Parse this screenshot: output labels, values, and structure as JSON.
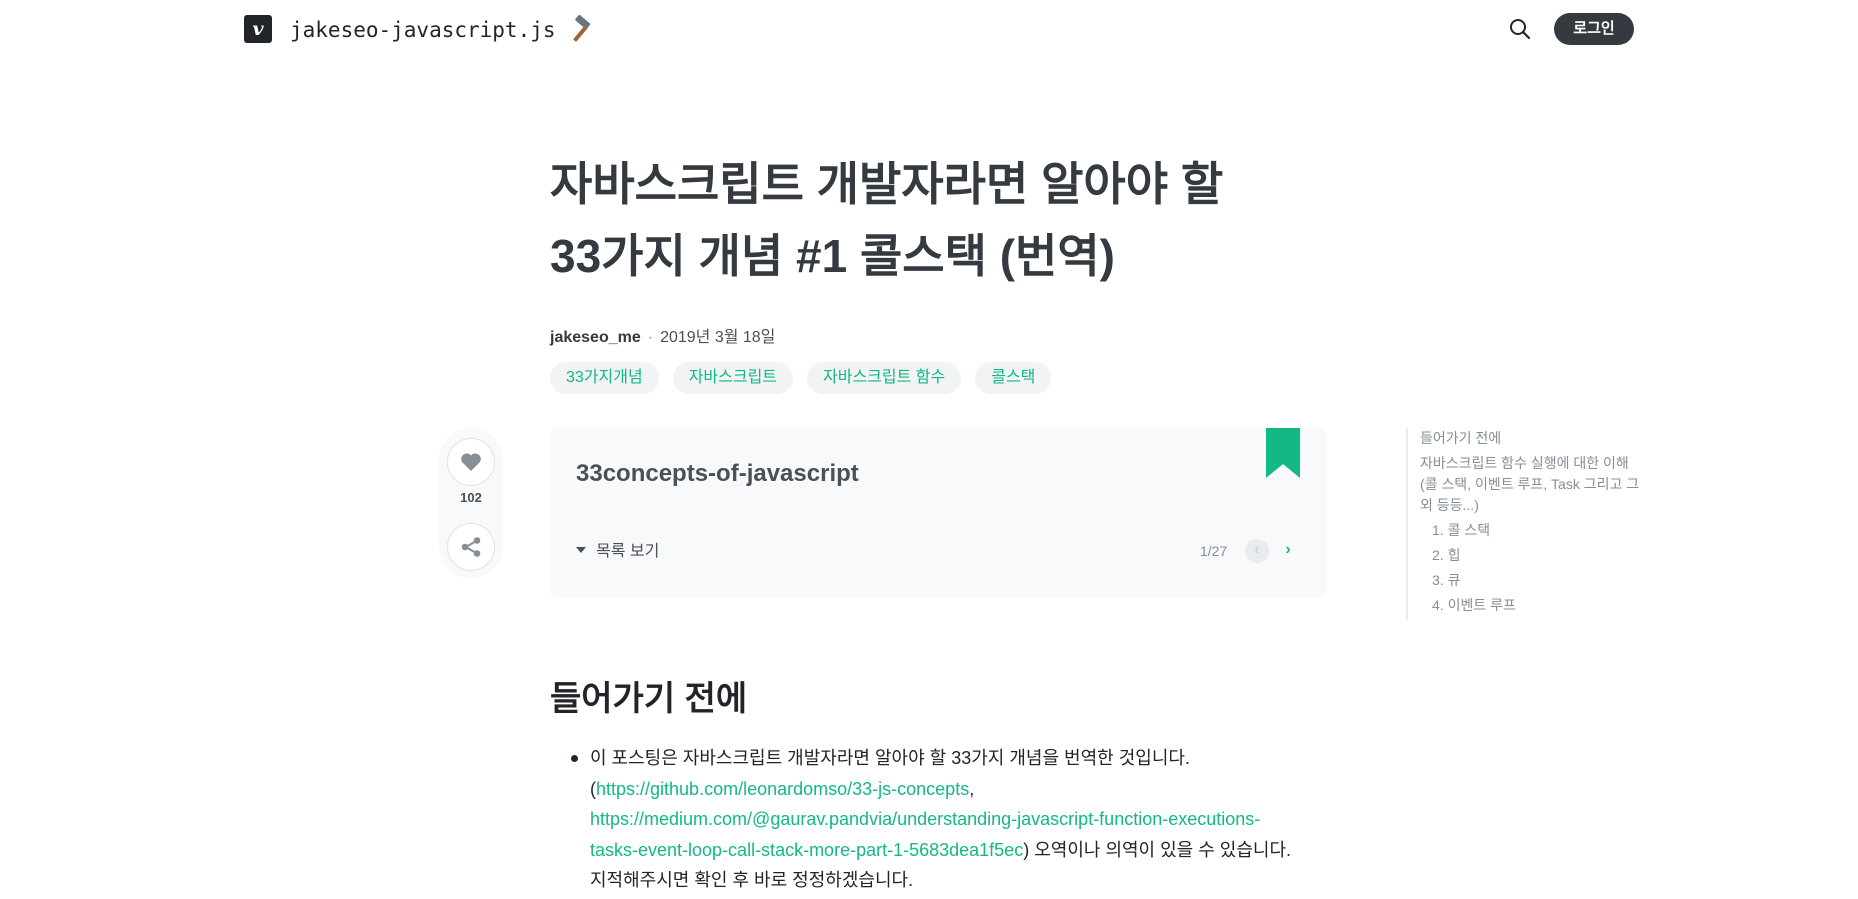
{
  "header": {
    "logo_letter": "v",
    "blog_name": "jakeseo-javascript.js",
    "login_label": "로그인"
  },
  "post": {
    "title_line1": "자바스크립트 개발자라면 알아야 할",
    "title_line2": "33가지 개념 #1 콜스택 (번역)",
    "author": "jakeseo_me",
    "separator": "·",
    "date": "2019년 3월 18일",
    "tags": [
      "33가지개념",
      "자바스크립트",
      "자바스크립트 함수",
      "콜스택"
    ],
    "like_count": "102"
  },
  "series": {
    "name": "33concepts-of-javascript",
    "toggle_label": "목록 보기",
    "page_indicator": "1/27"
  },
  "toc": {
    "items": [
      {
        "label": "들어가기 전에"
      },
      {
        "label": "자바스크립트 함수 실행에 대한 이해 (콜 스택, 이벤트 루프, Task 그리고 그 외 등등...)"
      },
      {
        "label": "1. 콜 스택"
      },
      {
        "label": "2. 힙"
      },
      {
        "label": "3. 큐"
      },
      {
        "label": "4. 이벤트 루프"
      }
    ]
  },
  "content": {
    "heading": "들어가기 전에",
    "para_start": "이 포스팅은 자바스크립트 개발자라면 알아야 할 33가지 개념을 번역한 것입니다.",
    "open_paren": "(",
    "link1": "https://github.com/leonardomso/33-js-concepts",
    "comma": ",",
    "link2": "https://medium.com/@gaurav.pandvia/understanding-javascript-function-executions-tasks-event-loop-call-stack-more-part-1-5683dea1f5ec",
    "para_end": ") 오역이나 의역이 있을 수 있습니다. 지적해주시면 확인 후 바로 정정하겠습니다."
  },
  "colors": {
    "accent": "#12b886",
    "dark": "#343a40"
  }
}
